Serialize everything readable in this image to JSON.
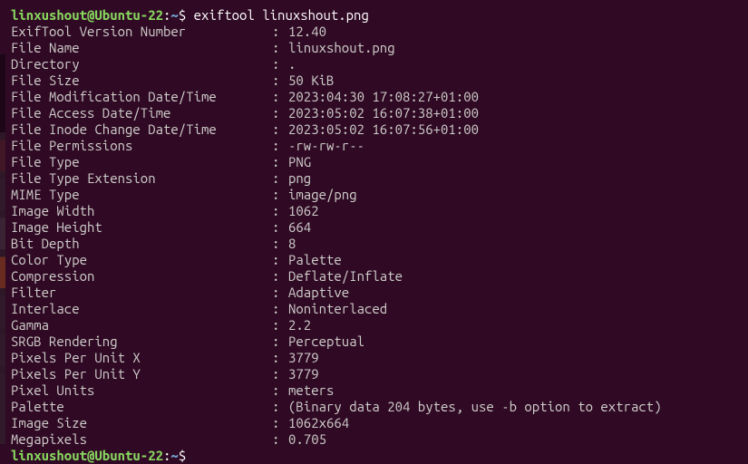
{
  "prompt": {
    "user": "linxushout@Ubuntu-22",
    "sep1": ":",
    "path": "~",
    "sep2": "$ ",
    "command": "exiftool linuxshout.png"
  },
  "lines": [
    {
      "key": "ExifTool Version Number",
      "value": "12.40"
    },
    {
      "key": "File Name",
      "value": "linuxshout.png"
    },
    {
      "key": "Directory",
      "value": "."
    },
    {
      "key": "File Size",
      "value": "50 KiB"
    },
    {
      "key": "File Modification Date/Time",
      "value": "2023:04:30 17:08:27+01:00"
    },
    {
      "key": "File Access Date/Time",
      "value": "2023:05:02 16:07:38+01:00"
    },
    {
      "key": "File Inode Change Date/Time",
      "value": "2023:05:02 16:07:56+01:00"
    },
    {
      "key": "File Permissions",
      "value": "-rw-rw-r--"
    },
    {
      "key": "File Type",
      "value": "PNG"
    },
    {
      "key": "File Type Extension",
      "value": "png"
    },
    {
      "key": "MIME Type",
      "value": "image/png"
    },
    {
      "key": "Image Width",
      "value": "1062"
    },
    {
      "key": "Image Height",
      "value": "664"
    },
    {
      "key": "Bit Depth",
      "value": "8"
    },
    {
      "key": "Color Type",
      "value": "Palette"
    },
    {
      "key": "Compression",
      "value": "Deflate/Inflate"
    },
    {
      "key": "Filter",
      "value": "Adaptive"
    },
    {
      "key": "Interlace",
      "value": "Noninterlaced"
    },
    {
      "key": "Gamma",
      "value": "2.2"
    },
    {
      "key": "SRGB Rendering",
      "value": "Perceptual"
    },
    {
      "key": "Pixels Per Unit X",
      "value": "3779"
    },
    {
      "key": "Pixels Per Unit Y",
      "value": "3779"
    },
    {
      "key": "Pixel Units",
      "value": "meters"
    },
    {
      "key": "Palette",
      "value": "(Binary data 204 bytes, use -b option to extract)"
    },
    {
      "key": "Image Size",
      "value": "1062x664"
    },
    {
      "key": "Megapixels",
      "value": "0.705"
    }
  ],
  "prompt2": {
    "user": "linxushout@Ubuntu-22",
    "sep1": ":",
    "path": "~",
    "sep2": "$"
  }
}
